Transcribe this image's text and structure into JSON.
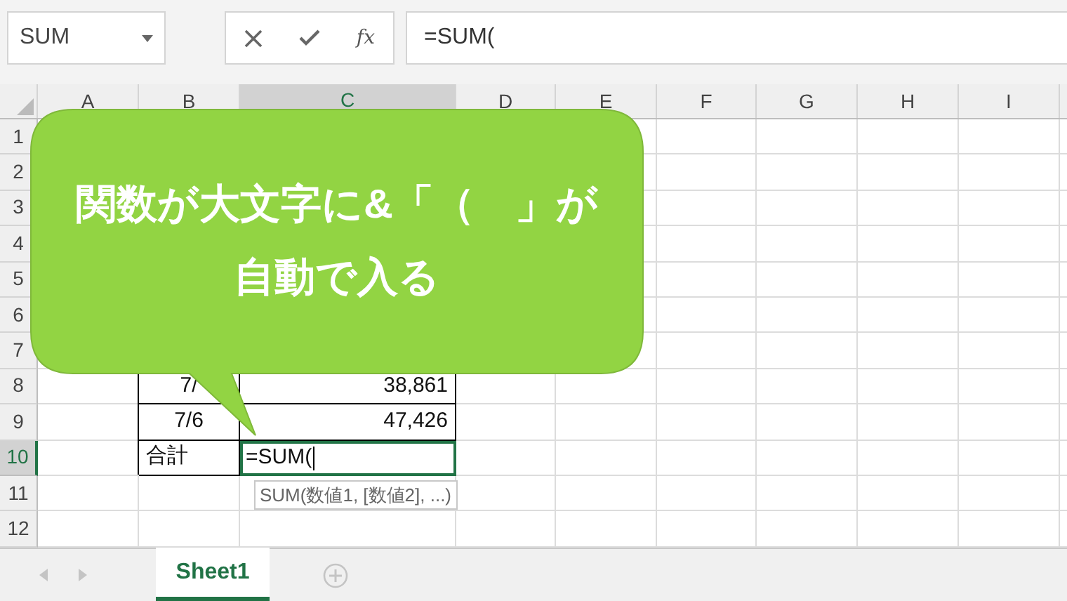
{
  "name_box": {
    "value": "SUM"
  },
  "formula_bar": {
    "function_label": "fx",
    "value": "=SUM("
  },
  "columns": [
    {
      "label": "A",
      "selected": false
    },
    {
      "label": "B",
      "selected": false
    },
    {
      "label": "C",
      "selected": true
    },
    {
      "label": "D",
      "selected": false
    },
    {
      "label": "E",
      "selected": false
    },
    {
      "label": "F",
      "selected": false
    },
    {
      "label": "G",
      "selected": false
    },
    {
      "label": "H",
      "selected": false
    },
    {
      "label": "I",
      "selected": false
    }
  ],
  "rows": [
    {
      "header": "1",
      "selected": false
    },
    {
      "header": "2",
      "selected": false
    },
    {
      "header": "3",
      "selected": false
    },
    {
      "header": "4",
      "selected": false
    },
    {
      "header": "5",
      "selected": false
    },
    {
      "header": "6",
      "selected": false
    },
    {
      "header": "7",
      "selected": false
    },
    {
      "header": "8",
      "selected": false,
      "cells": {
        "B": {
          "kind": "date",
          "text": "7/",
          "active": false
        },
        "C": {
          "kind": "number",
          "text": "38,861",
          "active": false
        }
      }
    },
    {
      "header": "9",
      "selected": false,
      "cells": {
        "B": {
          "kind": "date",
          "text": "7/6",
          "active": false
        },
        "C": {
          "kind": "number",
          "text": "47,426",
          "active": false
        }
      }
    },
    {
      "header": "10",
      "selected": true,
      "cells": {
        "B": {
          "kind": "text",
          "text": "合計",
          "active": false
        },
        "C": {
          "kind": "text",
          "text": "=SUM(",
          "active": true
        }
      }
    },
    {
      "header": "11",
      "selected": false
    },
    {
      "header": "12",
      "selected": false
    }
  ],
  "function_tooltip": "SUM(数値1, [数値2], ...)",
  "callout": {
    "lines": [
      "関数が大文字に&「（　」が",
      "自動で入る"
    ]
  },
  "sheet_tabs": [
    {
      "label": "Sheet1",
      "selected": true
    }
  ]
}
